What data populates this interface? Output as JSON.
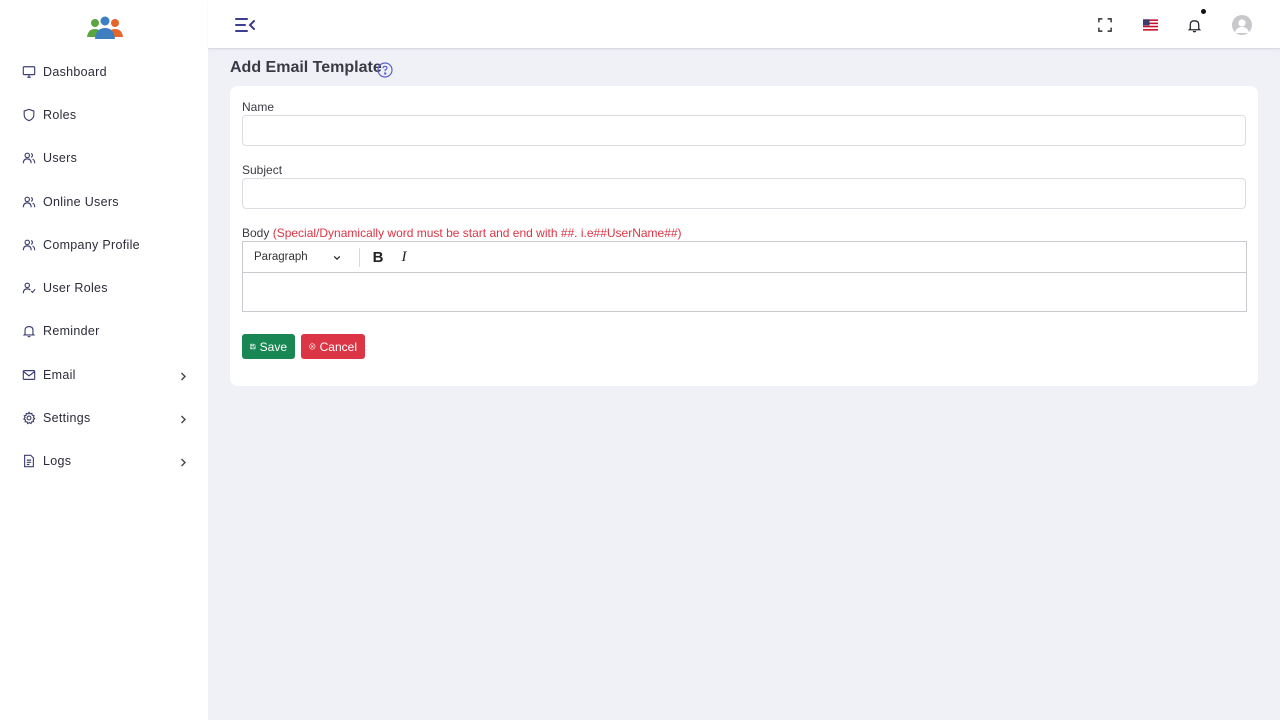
{
  "sidebar": {
    "items": [
      {
        "label": "Dashboard",
        "icon": "monitor-icon",
        "has_children": false
      },
      {
        "label": "Roles",
        "icon": "shield-icon",
        "has_children": false
      },
      {
        "label": "Users",
        "icon": "users-icon",
        "has_children": false
      },
      {
        "label": "Online Users",
        "icon": "users-icon",
        "has_children": false
      },
      {
        "label": "Company Profile",
        "icon": "users-icon",
        "has_children": false
      },
      {
        "label": "User Roles",
        "icon": "user-check-icon",
        "has_children": false
      },
      {
        "label": "Reminder",
        "icon": "bell-icon",
        "has_children": false
      },
      {
        "label": "Email",
        "icon": "mail-icon",
        "has_children": true
      },
      {
        "label": "Settings",
        "icon": "gear-icon",
        "has_children": true
      },
      {
        "label": "Logs",
        "icon": "document-icon",
        "has_children": true
      }
    ]
  },
  "page": {
    "title": "Add Email Template"
  },
  "form": {
    "name_label": "Name",
    "name_value": "",
    "subject_label": "Subject",
    "subject_value": "",
    "body_label": "Body",
    "body_hint": "(Special/Dynamically word must be start and end with ##. i.e##UserName##)",
    "editor_block_format": "Paragraph",
    "editor_bold": "B",
    "editor_italic": "I",
    "save_label": "Save",
    "cancel_label": "Cancel"
  },
  "colors": {
    "accent": "#3b3f8f",
    "save": "#198754",
    "cancel": "#dc3545",
    "hint": "#dc3545",
    "background": "#f0f1f7"
  }
}
